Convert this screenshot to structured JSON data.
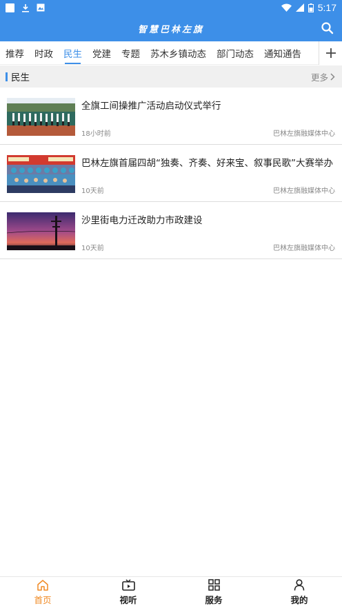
{
  "status_bar": {
    "time": "5:17",
    "icons": [
      "notification-square-icon",
      "download-icon",
      "image-icon",
      "wifi-icon",
      "signal-icon",
      "battery-icon"
    ]
  },
  "header": {
    "title": "智慧巴林左旗",
    "search_icon": "search-icon"
  },
  "tabs": [
    {
      "label": "推荐",
      "active": false
    },
    {
      "label": "时政",
      "active": false
    },
    {
      "label": "民生",
      "active": true
    },
    {
      "label": "党建",
      "active": false
    },
    {
      "label": "专题",
      "active": false
    },
    {
      "label": "苏木乡镇动态",
      "active": false
    },
    {
      "label": "部门动态",
      "active": false
    },
    {
      "label": "通知通告",
      "active": false
    }
  ],
  "section": {
    "title": "民生",
    "more": "更多"
  },
  "news": [
    {
      "title": "全旗工间操推广活动启动仪式举行",
      "time": "18小时前",
      "source": "巴林左旗融媒体中心",
      "thumb": "outdoor-exercise-photo"
    },
    {
      "title": "巴林左旗首届四胡“独奏、齐奏、好来宝、叙事民歌”大赛举办",
      "time": "10天前",
      "source": "巴林左旗融媒体中心",
      "thumb": "group-photo"
    },
    {
      "title": "沙里街电力迁改助力市政建设",
      "time": "10天前",
      "source": "巴林左旗融媒体中心",
      "thumb": "sunset-power-pole-photo"
    }
  ],
  "bottom_nav": [
    {
      "label": "首页",
      "icon": "home-icon",
      "active": true
    },
    {
      "label": "视听",
      "icon": "tv-icon",
      "active": false
    },
    {
      "label": "服务",
      "icon": "grid-icon",
      "active": false
    },
    {
      "label": "我的",
      "icon": "person-icon",
      "active": false
    }
  ],
  "colors": {
    "primary": "#3d8fe8",
    "active_nav": "#f08a24"
  }
}
